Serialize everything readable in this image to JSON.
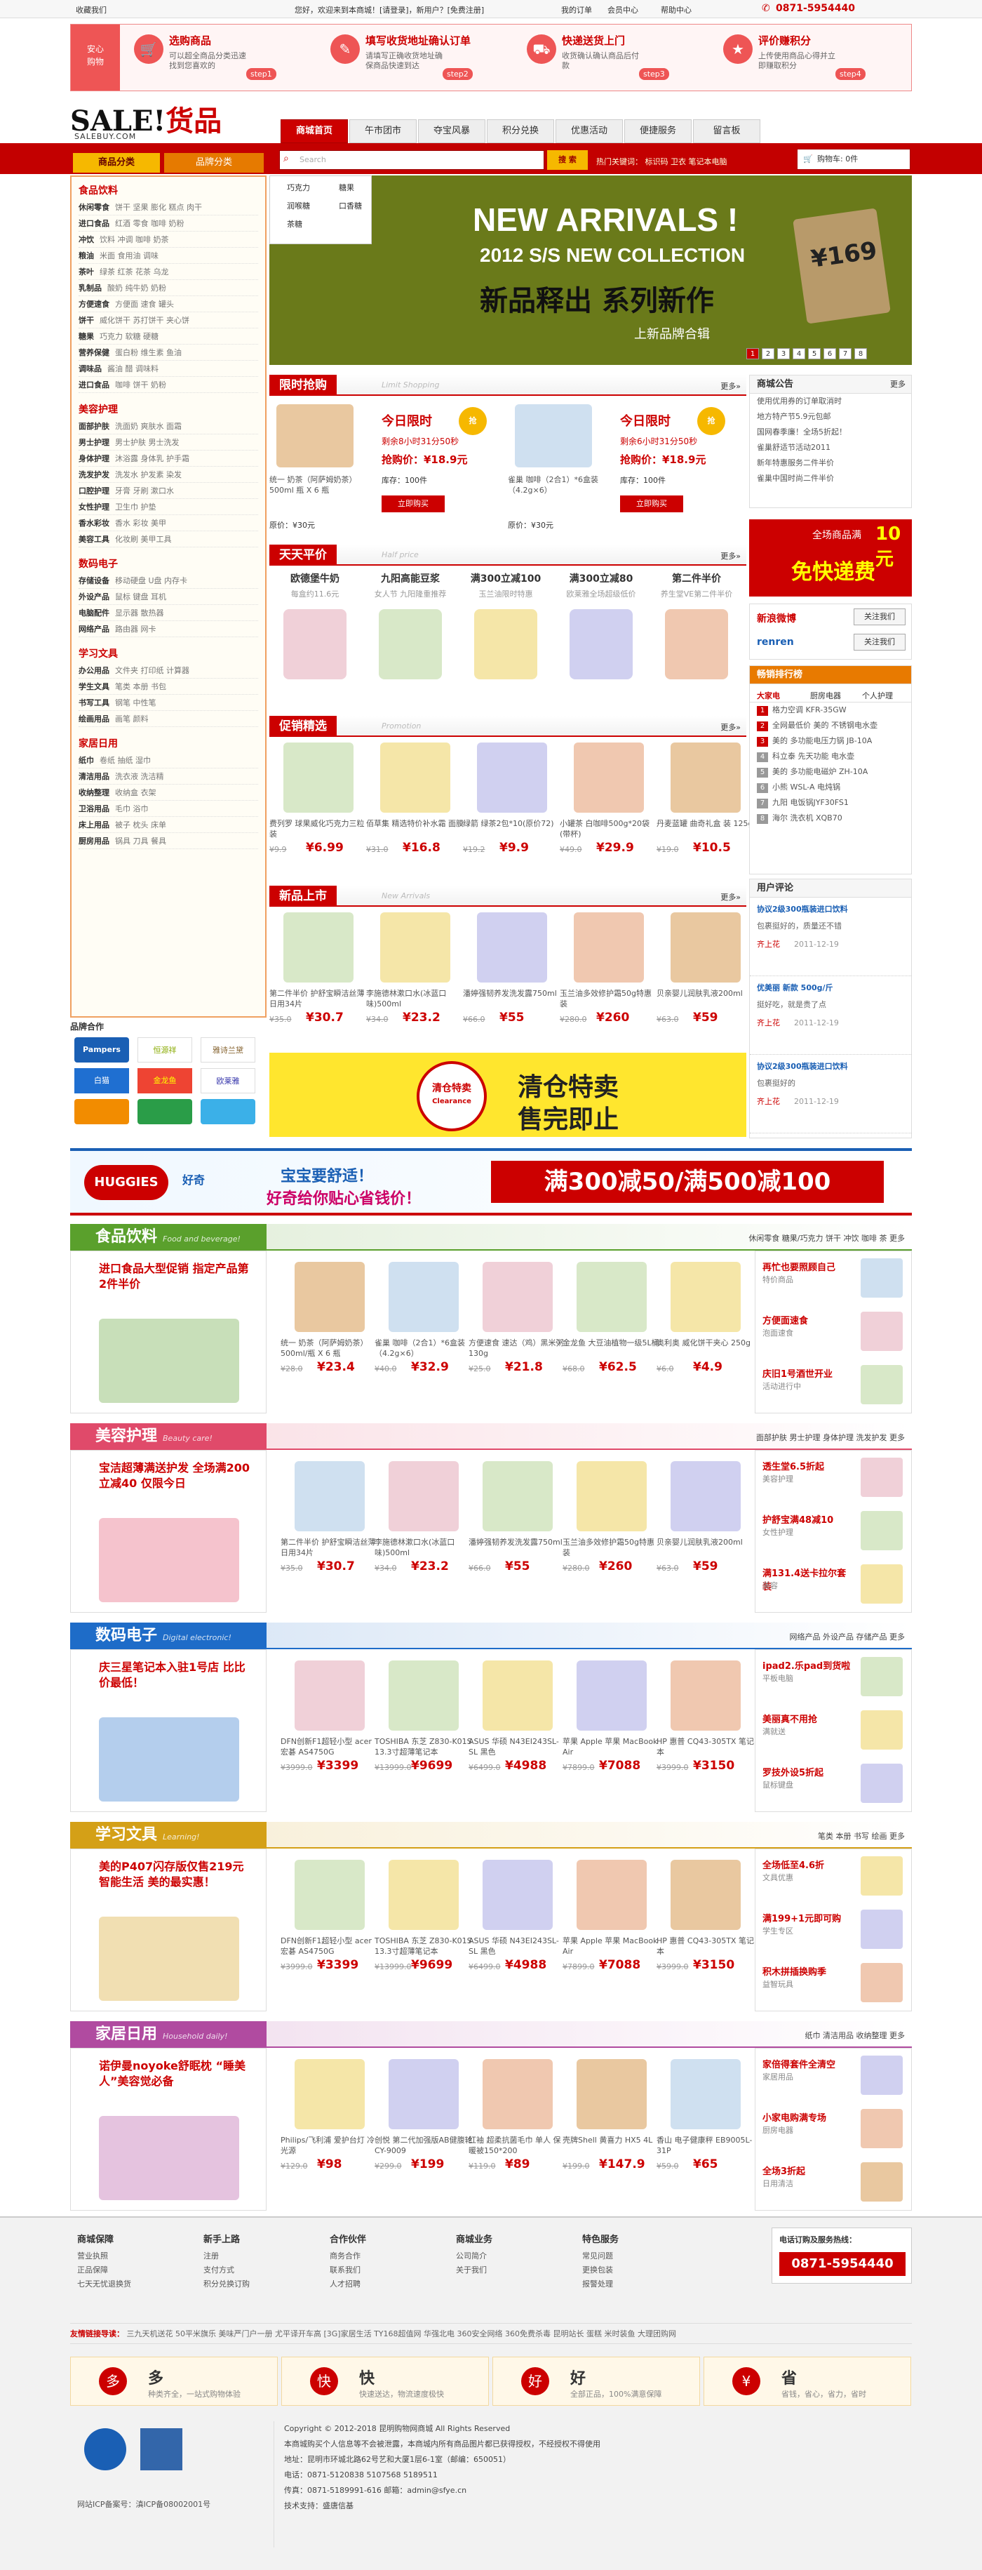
{
  "topbar": {
    "fav": "收藏我们",
    "welcome": "您好，欢迎来到本商城！[请登录]，新用户？[免费注册]",
    "links": [
      "我的订单",
      "会员中心",
      "帮助中心"
    ],
    "phone": "0871-5954440"
  },
  "steps": [
    {
      "title": "选购商品",
      "desc": "可以超全商品分类迅速找到您喜欢的",
      "num": "step1",
      "icon": "cart-icon"
    },
    {
      "title": "填写收货地址确认订单",
      "desc": "请填写正确收货地址确保商品快速到达",
      "num": "step2",
      "icon": "form-icon"
    },
    {
      "title": "快递送货上门",
      "desc": "收货确认确认商品后付款",
      "num": "step3",
      "icon": "truck-icon"
    },
    {
      "title": "评价赚积分",
      "desc": "上传使用商品心得并立即赚取积分",
      "num": "step4",
      "icon": "star-icon"
    }
  ],
  "header": {
    "logo_en": "SALE!",
    "logo_cn": "货品",
    "logo_sub": "SALEBUY.COM",
    "nav": [
      "商城首页",
      "午市团市",
      "夺宝风暴",
      "积分兑换",
      "优惠活动",
      "便捷服务",
      "留言板"
    ]
  },
  "searchbar": {
    "cat_tabs": [
      "商品分类",
      "品牌分类"
    ],
    "placeholder": "Search",
    "button": "搜 索",
    "hot": "热门关键词：  标识码  卫衣  笔记本电脑",
    "cart": "购物车: 0件"
  },
  "categories": [
    {
      "name": "食品饮料",
      "rows": [
        [
          "休闲零食",
          "饼干 坚果 膨化 糕点 肉干"
        ],
        [
          "进口食品",
          "红酒 零食 咖啡 奶粉"
        ],
        [
          "冲饮",
          "饮料 冲调 咖啡 奶茶"
        ],
        [
          "粮油",
          "米面 食用油 调味"
        ],
        [
          "茶叶",
          "绿茶 红茶 花茶 乌龙"
        ],
        [
          "乳制品",
          "酸奶 纯牛奶 奶粉"
        ],
        [
          "方便速食",
          "方便面 速食 罐头"
        ],
        [
          "饼干",
          "威化饼干 苏打饼干 夹心饼"
        ],
        [
          "糖果",
          "巧克力 软糖 硬糖"
        ],
        [
          "营养保健",
          "蛋白粉 维生素 鱼油"
        ],
        [
          "调味品",
          "酱油 醋 调味料"
        ],
        [
          "进口食品",
          "咖啡 饼干 奶粉"
        ]
      ]
    },
    {
      "name": "美容护理",
      "rows": [
        [
          "面部护肤",
          "洗面奶 爽肤水 面霜"
        ],
        [
          "男士护理",
          "男士护肤 男士洗发"
        ],
        [
          "身体护理",
          "沐浴露 身体乳 护手霜"
        ],
        [
          "洗发护发",
          "洗发水 护发素 染发"
        ],
        [
          "口腔护理",
          "牙膏 牙刷 漱口水"
        ],
        [
          "女性护理",
          "卫生巾 护垫"
        ],
        [
          "香水彩妆",
          "香水 彩妆 美甲"
        ],
        [
          "美容工具",
          "化妆刷 美甲工具"
        ]
      ]
    },
    {
      "name": "数码电子",
      "rows": [
        [
          "存储设备",
          "移动硬盘 U盘 内存卡"
        ],
        [
          "外设产品",
          "鼠标 键盘 耳机"
        ],
        [
          "电脑配件",
          "显示器 散热器"
        ],
        [
          "网络产品",
          "路由器 网卡"
        ]
      ]
    },
    {
      "name": "学习文具",
      "rows": [
        [
          "办公用品",
          "文件夹 打印纸 计算器"
        ],
        [
          "学生文具",
          "笔类 本册 书包"
        ],
        [
          "书写工具",
          "钢笔 中性笔"
        ],
        [
          "绘画用品",
          "画笔 颜料"
        ]
      ]
    },
    {
      "name": "家居日用",
      "rows": [
        [
          "纸巾",
          "卷纸 抽纸 湿巾"
        ],
        [
          "清洁用品",
          "洗衣液 洗洁精"
        ],
        [
          "收纳整理",
          "收纳盒 衣架"
        ],
        [
          "卫浴用品",
          "毛巾 浴巾"
        ],
        [
          "床上用品",
          "被子 枕头 床单"
        ],
        [
          "厨房用品",
          "锅具 刀具 餐具"
        ]
      ]
    }
  ],
  "brands": {
    "title": "品牌合作",
    "items": [
      "Pampers",
      "恒源祥",
      "白猫",
      "金龙鱼",
      "雅诗兰黛",
      "欧莱雅"
    ]
  },
  "banner": {
    "line1": "NEW ARRIVALS !",
    "line2": "2012 S/S NEW COLLECTION",
    "line3": "新品释出 系列新作",
    "line4": "上新品牌合辑",
    "tag": "¥169",
    "pages": [
      "1",
      "2",
      "3",
      "4",
      "5",
      "6",
      "7",
      "8"
    ],
    "menu": [
      "巧克力",
      "糖果",
      "润喉糖",
      "口香糖",
      "茶糖"
    ]
  },
  "limited": {
    "title": "限时抢购",
    "en": "Limit Shopping",
    "more": "更多»",
    "items": [
      {
        "label": "今日限时",
        "timer": "剩余8小时31分50秒",
        "price": "抢购价：¥18.9元",
        "stock": "库存：100件",
        "ref": "原价：¥30元",
        "btn": "立即购买",
        "name": "统一 奶茶（阿萨姆奶茶）500ml 瓶 X 6 瓶"
      },
      {
        "label": "今日限时",
        "timer": "剩余6小时31分50秒",
        "price": "抢购价：¥18.9元",
        "stock": "库存：100件",
        "ref": "原价：¥30元",
        "btn": "立即购买",
        "name": "雀巢 咖啡（2合1）*6盒装（4.2g×6）"
      }
    ]
  },
  "daily": {
    "title": "天天平价",
    "en": "Half price",
    "more": "更多»",
    "items": [
      {
        "name": "欧德堡牛奶",
        "sub": "每盒约11.6元"
      },
      {
        "name": "九阳高能豆浆",
        "sub": "女人节 九阳隆重推荐"
      },
      {
        "name": "满300立减100",
        "sub": "玉兰油限时特惠"
      },
      {
        "name": "满300立减80",
        "sub": "欧莱雅全场超级低价"
      },
      {
        "name": "第二件半价",
        "sub": "养生堂VE第二件半价"
      }
    ]
  },
  "promotion": {
    "title": "促销精选",
    "en": "Promotion",
    "more": "更多»",
    "items": [
      {
        "name": "费列罗 球果威化巧克力三粒装",
        "old": "¥9.9",
        "new": "¥6.99"
      },
      {
        "name": "佰草集 精选特价补水霜 面膜",
        "old": "¥31.0",
        "new": "¥16.8"
      },
      {
        "name": "绿箭 绿茶2包*10(原价72)",
        "old": "¥19.2",
        "new": "¥9.9"
      },
      {
        "name": "小罐茶 白咖啡500g*20袋(带杯)",
        "old": "¥49.0",
        "new": "¥29.9"
      },
      {
        "name": "丹麦蓝罐 曲奇礼盒 装 125g",
        "old": "¥19.0",
        "new": "¥10.5"
      }
    ]
  },
  "newarrivals": {
    "title": "新品上市",
    "en": "New Arrivals",
    "more": "更多»",
    "items": [
      {
        "name": "第二件半价 护舒宝瞬洁丝薄日用34片",
        "old": "¥35.0",
        "new": "¥30.7"
      },
      {
        "name": "李施德林漱口水(冰蓝口味)500ml",
        "old": "¥34.0",
        "new": "¥23.2"
      },
      {
        "name": "潘婷强韧养发洗发露750ml",
        "old": "¥66.0",
        "new": "¥55"
      },
      {
        "name": "玉兰油多效修护霜50g特惠装",
        "old": "¥280.0",
        "new": "¥260"
      },
      {
        "name": "贝亲婴儿润肤乳液200ml",
        "old": "¥63.0",
        "new": "¥59"
      }
    ]
  },
  "notice": {
    "title": "商城公告",
    "more": "更多",
    "rows": [
      "使用优用券的订单取消时",
      "地方特产节5.9元包邮",
      "国网春季廉！全场5折起！",
      "雀巢舒适节活动2011",
      "新年特惠服务二件半价",
      "雀巢中国时尚二件半价"
    ]
  },
  "freeship": {
    "line1": "全场商品满",
    "amount": "10元",
    "line2": "免快递费"
  },
  "social": {
    "weibo": "新浪微博",
    "renren": "renren",
    "follow": "关注我们"
  },
  "ranking": {
    "title": "畅销排行榜",
    "tabs": [
      "大家电",
      "厨房电器",
      "个人护理"
    ],
    "rows": [
      "格力空调 KFR-35GW",
      "全网最低价 美的 不锈钢电水壶",
      "美的 多功能电压力锅 JB-10A",
      "科立泰 先天功能 电水壶",
      "美的 多功能电磁炉 ZH-10A",
      "小熊 WSL-A 电炖锅",
      "九阳 电饭锅JYF30FS1",
      "海尔 洗衣机 XQB70"
    ]
  },
  "comments": {
    "title": "用户评论",
    "rows": [
      {
        "title": "协议2级300瓶装进口饮料",
        "body": "包裹挺好的，质量还不错",
        "user": "齐上花",
        "date": "2011-12-19"
      },
      {
        "title": "优美丽 新款 500g/斤",
        "body": "挺好吃，就是贵了点",
        "user": "齐上花",
        "date": "2011-12-19"
      },
      {
        "title": "协议2级300瓶装进口饮料",
        "body": "包裹挺好的",
        "user": "齐上花",
        "date": "2011-12-19"
      }
    ]
  },
  "clearance": {
    "badge": "清仓特卖",
    "en": "Clearance",
    "line1": "清仓特卖",
    "line2": "售完即止"
  },
  "huggies": {
    "brand": "HUGGIES",
    "sub": "好奇",
    "l1": "宝宝要舒适！",
    "l2": "好奇给你贴心省钱价！",
    "deal": "满300减50/满500减100"
  },
  "floors": [
    {
      "key": "food",
      "title": "食品饮料",
      "en": "Food and beverage!",
      "color": "#5aa02c",
      "tags": "休闲零食  糖果/巧克力  饼干  冲饮  咖啡  茶  更多",
      "promo": "进口食品大型促销 指定产品第2件半价",
      "items": [
        {
          "name": "统一 奶茶（阿萨姆奶茶）500ml/瓶 X 6 瓶",
          "old": "¥28.0",
          "new": "¥23.4"
        },
        {
          "name": "雀巢 咖啡（2合1）*6盒装（4.2g×6）",
          "old": "¥40.0",
          "new": "¥32.9"
        },
        {
          "name": "方便速食 速达（鸡）黑米粥 130g",
          "old": "¥25.0",
          "new": "¥21.8"
        },
        {
          "name": "金龙鱼 大豆油植物一级5L桶",
          "old": "¥68.0",
          "new": "¥62.5"
        },
        {
          "name": "奥利奥 威化饼干夹心 250g",
          "old": "¥6.0",
          "new": "¥4.9"
        }
      ],
      "side": [
        {
          "t": "再忙也要照顾自己",
          "d": "特价商品"
        },
        {
          "t": "方便面速食",
          "d": "泡面速食"
        },
        {
          "t": "庆旧1号酒世开业",
          "d": "活动进行中"
        }
      ]
    },
    {
      "key": "beauty",
      "title": "美容护理",
      "en": "Beauty care!",
      "color": "#e04a6a",
      "tags": "面部护肤  男士护理  身体护理  洗发护发  更多",
      "promo": "宝洁超薄满送护发 全场满200立减40 仅限今日",
      "items": [
        {
          "name": "第二件半价 护舒宝瞬洁丝薄日用34片",
          "old": "¥35.0",
          "new": "¥30.7"
        },
        {
          "name": "李施德林漱口水(冰蓝口味)500ml",
          "old": "¥34.0",
          "new": "¥23.2"
        },
        {
          "name": "潘婷强韧养发洗发露750ml",
          "old": "¥66.0",
          "new": "¥55"
        },
        {
          "name": "玉兰油多效修护霜50g特惠装",
          "old": "¥280.0",
          "new": "¥260"
        },
        {
          "name": "贝亲婴儿润肤乳液200ml",
          "old": "¥63.0",
          "new": "¥59"
        }
      ],
      "side": [
        {
          "t": "透生堂6.5折起",
          "d": "美容护理"
        },
        {
          "t": "护舒宝满48减10",
          "d": "女性护理"
        },
        {
          "t": "满131.4送卡拉尔套装",
          "d": "美容"
        }
      ]
    },
    {
      "key": "digital",
      "title": "数码电子",
      "en": "Digital electronic!",
      "color": "#1e6cc8",
      "tags": "网络产品  外设产品  存储产品  更多",
      "promo": "庆三星笔记本入驻1号店 比比价最低！",
      "items": [
        {
          "name": "DFN创新F1超轻小型 acer 宏碁 AS4750G",
          "old": "¥3999.0",
          "new": "¥3399"
        },
        {
          "name": "TOSHIBA 东芝 Z830-K01S 13.3寸超薄笔记本",
          "old": "¥13999.0",
          "new": "¥9699"
        },
        {
          "name": "ASUS 华硕 N43EI243SL-SL 黑色",
          "old": "¥6499.0",
          "new": "¥4988"
        },
        {
          "name": "苹果 Apple 苹果 MacBook Air",
          "old": "¥7899.0",
          "new": "¥7088"
        },
        {
          "name": "HP 惠普 CQ43-305TX 笔记本",
          "old": "¥3999.0",
          "new": "¥3150"
        }
      ],
      "side": [
        {
          "t": "ipad2.乐pad到货啦",
          "d": "平板电脑"
        },
        {
          "t": "美丽真不用抢",
          "d": "满就送"
        },
        {
          "t": "罗技外设5折起",
          "d": "鼠标键盘"
        }
      ]
    },
    {
      "key": "stationery",
      "title": "学习文具",
      "en": "Learning!",
      "color": "#d4a017",
      "tags": "笔类  本册  书写  绘画  更多",
      "promo": "美的P407闪存版仅售219元 智能生活 美的最实惠！",
      "items": [
        {
          "name": "DFN创新F1超轻小型 acer 宏碁 AS4750G",
          "old": "¥3999.0",
          "new": "¥3399"
        },
        {
          "name": "TOSHIBA 东芝 Z830-K01S 13.3寸超薄笔记本",
          "old": "¥13999.0",
          "new": "¥9699"
        },
        {
          "name": "ASUS 华硕 N43EI243SL-SL 黑色",
          "old": "¥6499.0",
          "new": "¥4988"
        },
        {
          "name": "苹果 Apple 苹果 MacBook Air",
          "old": "¥7899.0",
          "new": "¥7088"
        },
        {
          "name": "HP 惠普 CQ43-305TX 笔记本",
          "old": "¥3999.0",
          "new": "¥3150"
        }
      ],
      "side": [
        {
          "t": "全场低至4.6折",
          "d": "文具优惠"
        },
        {
          "t": "满199+1元即可购",
          "d": "学生专区"
        },
        {
          "t": "积木拼插换购季",
          "d": "益智玩具"
        }
      ]
    },
    {
      "key": "home",
      "title": "家居日用",
      "en": "Household daily!",
      "color": "#b04ba0",
      "tags": "纸巾  清洁用品  收纳整理  更多",
      "promo": "诺伊曼noyoke舒眠枕 “睡美人”美容觉必备",
      "items": [
        {
          "name": "Philips/飞利浦 爱护台灯 冷光源",
          "old": "¥129.0",
          "new": "¥98"
        },
        {
          "name": "创悦 第二代加强版AB健腹轮 CY-9009",
          "old": "¥299.0",
          "new": "¥199"
        },
        {
          "name": "红袖 超柔抗菌毛巾 单人 保暖被150*200",
          "old": "¥119.0",
          "new": "¥89"
        },
        {
          "name": "壳牌Shell 黄喜力 HX5 4L",
          "old": "¥199.0",
          "new": "¥147.9"
        },
        {
          "name": "香山 电子健康秤 EB9005L-31P",
          "old": "¥59.0",
          "new": "¥65"
        }
      ],
      "side": [
        {
          "t": "家倍得套件全清空",
          "d": "家居用品"
        },
        {
          "t": "小家电购满专场",
          "d": "厨房电器"
        },
        {
          "t": "全场3折起",
          "d": "日用清洁"
        }
      ]
    }
  ],
  "footer": {
    "cols": [
      {
        "h": "商城保障",
        "rows": [
          "营业执照",
          "正品保障",
          "七天无忧退换货"
        ]
      },
      {
        "h": "新手上路",
        "rows": [
          "注册",
          "支付方式",
          "积分兑换订购"
        ]
      },
      {
        "h": "合作伙伴",
        "rows": [
          "商务合作",
          "联系我们",
          "人才招聘"
        ]
      },
      {
        "h": "商城业务",
        "rows": [
          "公司简介",
          "关于我们"
        ]
      },
      {
        "h": "特色服务",
        "rows": [
          "常见问题",
          "更换包装",
          "报警处理"
        ]
      }
    ],
    "hotline_t": "电话订购及服务热线：",
    "hotline": "0871-5954440",
    "links_t": "友情链接导读：",
    "links": "三九天机送花  50平米旗乐  美味严门户一册  尤平译开车高  [3G]家居生活  TY168超值网  华强北电  360安全网络  360免费杀毒  昆明站长  蛋糕  米时装鱼  大理团购网",
    "feats": [
      {
        "t": "多",
        "d": "种类齐全，一站式购物体验",
        "i": "多"
      },
      {
        "t": "快",
        "d": "快速送达，物流速度极快",
        "i": "快"
      },
      {
        "t": "好",
        "d": "全部正品，100%满意保障",
        "i": "好"
      },
      {
        "t": "省",
        "d": "省钱，省心，省力，省时",
        "i": "¥"
      }
    ],
    "copy": [
      "Copyright © 2012-2018 昆明购物网商城  All Rights Reserved",
      "本商城购买个人信息等不会被泄露，本商城内所有商品图片都已获得授权，不经授权不得使用",
      "地址：昆明市环城北路62号艺和大厦1层6-1室（邮编：650051）",
      "电话：0871-5120838 5107568 5189511",
      "传真：0871-5189991-616  邮箱：admin@sfye.cn",
      "技术支持：盛唐信基"
    ],
    "icp": "网站ICP备案号：滇ICP备08002001号"
  }
}
